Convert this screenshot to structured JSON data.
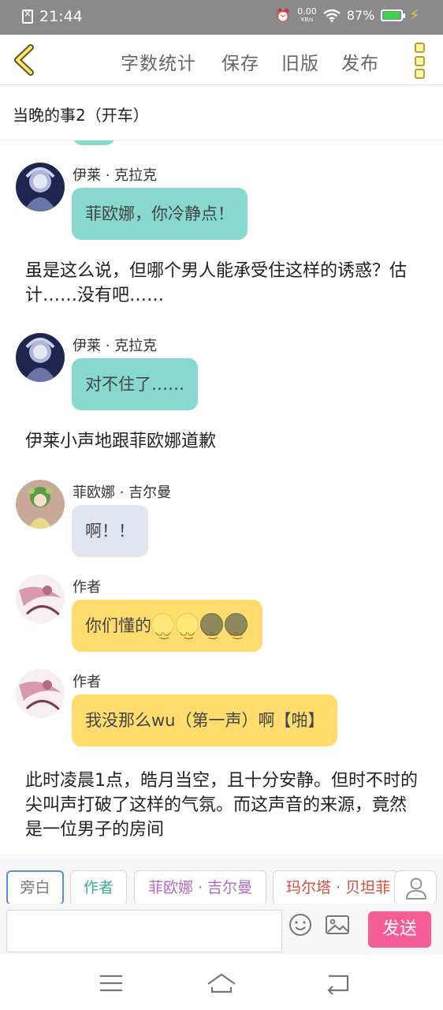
{
  "status_bar": {
    "time": "21:44",
    "speed": "0.00",
    "speed_unit": "KB/s",
    "battery": "87%"
  },
  "toolbar": {
    "word_count": "字数统计",
    "save": "保存",
    "old_version": "旧版",
    "publish": "发布"
  },
  "title": "当晚的事2（开车）",
  "messages": [
    {
      "name": "伊莱 · 克拉克",
      "text": "菲欧娜，你冷静点！"
    },
    {
      "narration": "虽是这么说，但哪个男人能承受住这样的诱惑？估计……没有吧……"
    },
    {
      "name": "伊莱 · 克拉克",
      "text": "对不住了……"
    },
    {
      "narration": "伊莱小声地跟菲欧娜道歉"
    },
    {
      "name": "菲欧娜 · 吉尔曼",
      "text": "啊！！"
    },
    {
      "name": "作者",
      "text": "你们懂的"
    },
    {
      "name": "作者",
      "text": "我没那么wu（第一声）啊【啪】"
    },
    {
      "narration": "此时凌晨1点，皓月当空，且十分安静。但时不时的尖叫声打破了这样的气氛。而这声音的来源，竟然是一位男子的房间"
    }
  ],
  "roles": [
    {
      "label": "旁白",
      "color": "#777777"
    },
    {
      "label": "作者",
      "color": "#3aa9a0"
    },
    {
      "label": "菲欧娜 · 吉尔曼",
      "color": "#b06ac6"
    },
    {
      "label": "玛尔塔 · 贝坦菲",
      "color": "#d94a3a"
    }
  ],
  "input": {
    "value": "",
    "send": "发送"
  },
  "colors": {
    "teal_bubble": "#88d9cd",
    "gray_bubble": "#e1e6ee",
    "yellow_bubble": "#ffdc6e",
    "send": "#f45d96",
    "accent_icon": "#f5c431"
  }
}
